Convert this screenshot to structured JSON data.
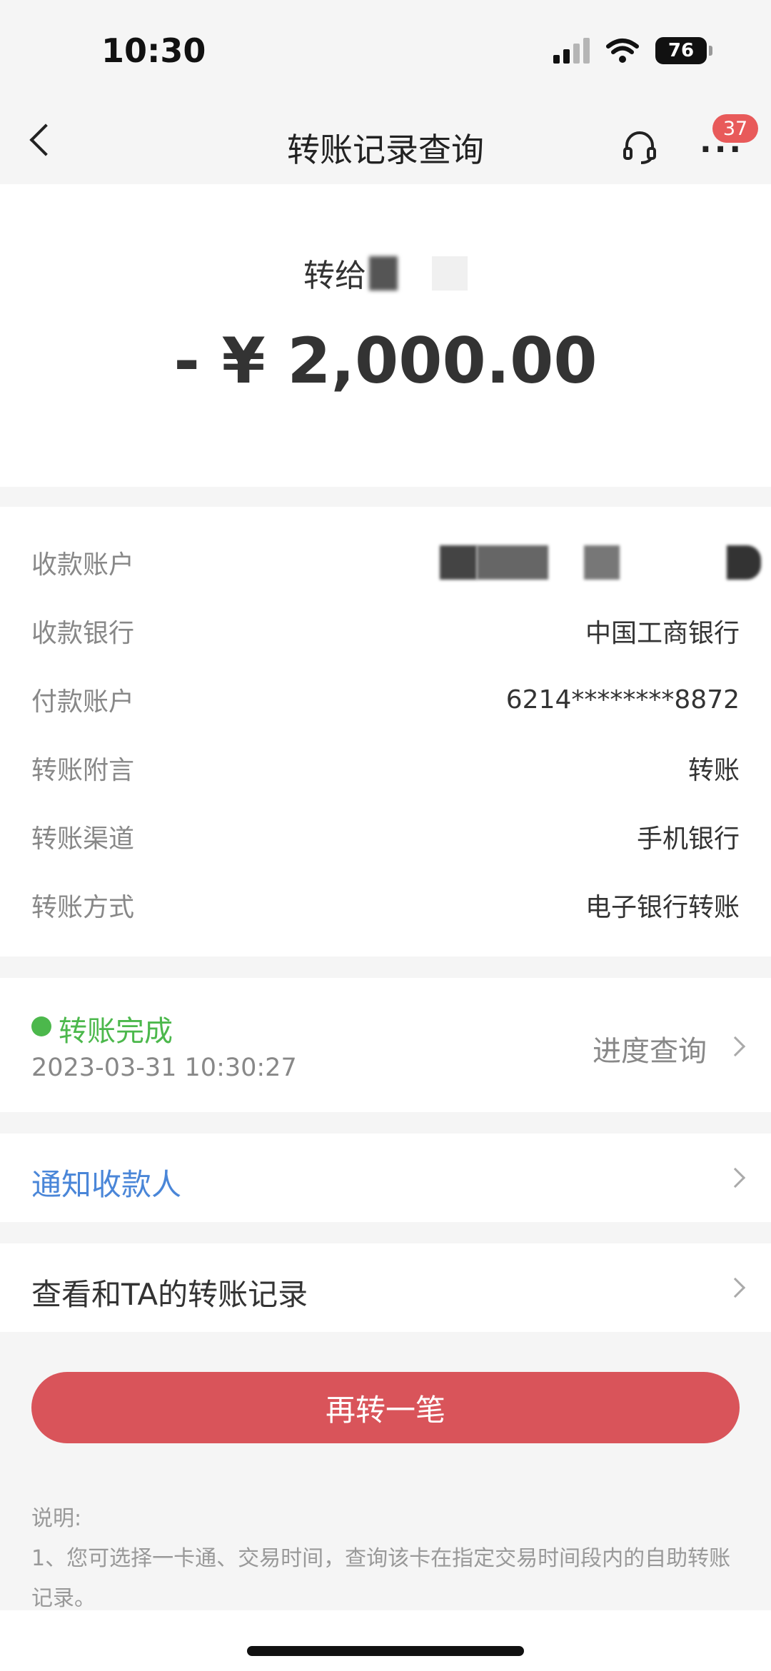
{
  "status_bar": {
    "time": "10:30",
    "battery": "76"
  },
  "nav": {
    "title": "转账记录查询",
    "badge": "37"
  },
  "hero": {
    "recipient_prefix": "转给",
    "amount": "- ¥ 2,000.00"
  },
  "details": [
    {
      "label": "收款账户",
      "value": ""
    },
    {
      "label": "收款银行",
      "value": "中国工商银行"
    },
    {
      "label": "付款账户",
      "value": "6214********8872"
    },
    {
      "label": "转账附言",
      "value": "转账"
    },
    {
      "label": "转账渠道",
      "value": "手机银行"
    },
    {
      "label": "转账方式",
      "value": "电子银行转账"
    }
  ],
  "status": {
    "text": "转账完成",
    "time": "2023-03-31 10:30:27",
    "progress_link": "进度查询",
    "color": "#4cb84c"
  },
  "notify": {
    "label": "通知收款人"
  },
  "history": {
    "label": "查看和TA的转账记录"
  },
  "action": {
    "label": "再转一笔",
    "color": "#d9545a"
  },
  "notes": {
    "title": "说明:",
    "line1": "1、您可选择一卡通、交易时间，查询该卡在指定交易时间段内的自助转账记录。"
  }
}
